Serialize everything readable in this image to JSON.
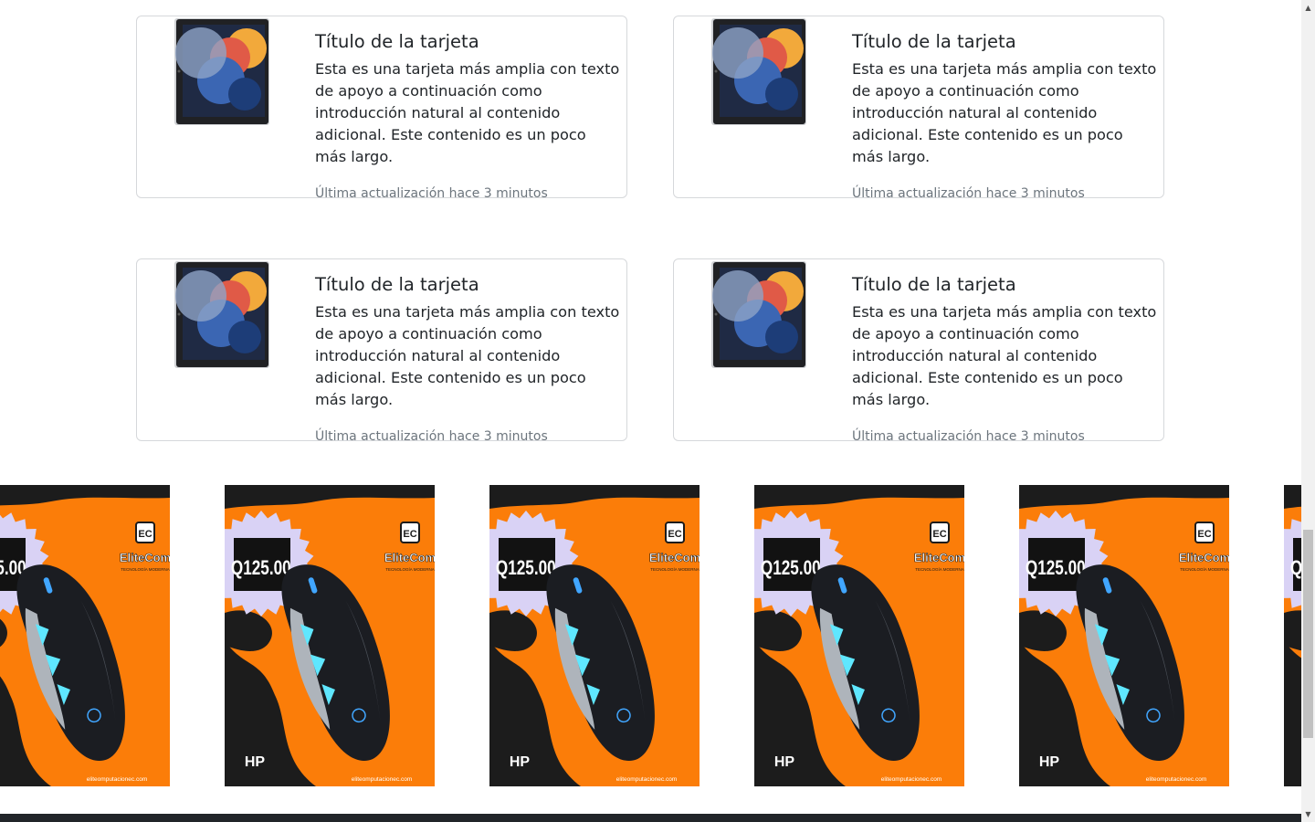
{
  "cards": [
    {
      "title": "Título de la tarjeta",
      "text": "Esta es una tarjeta más amplia con texto de apoyo a continuación como introducción natural al contenido adicional. Este contenido es un poco más largo.",
      "updated": "Última actualización hace 3 minutos"
    },
    {
      "title": "Título de la tarjeta",
      "text": "Esta es una tarjeta más amplia con texto de apoyo a continuación como introducción natural al contenido adicional. Este contenido es un poco más largo.",
      "updated": "Última actualización hace 3 minutos"
    },
    {
      "title": "Título de la tarjeta",
      "text": "Esta es una tarjeta más amplia con texto de apoyo a continuación como introducción natural al contenido adicional. Este contenido es un poco más largo.",
      "updated": "Última actualización hace 3 minutos"
    },
    {
      "title": "Título de la tarjeta",
      "text": "Esta es una tarjeta más amplia con texto de apoyo a continuación como introducción natural al contenido adicional. Este contenido es un poco más largo.",
      "updated": "Última actualización hace 3 minutos"
    }
  ],
  "promo": {
    "price": "Q125.00",
    "brand": "EliteCom",
    "brand_tagline": "TECNOLOGÍA MODERNA",
    "brand_badge": "EC",
    "product_brand": "HP",
    "website": "eliteomputacionec.com",
    "accent": "#fb7d09"
  },
  "scrollbar": {
    "up_icon": "▲",
    "down_icon": "▼"
  }
}
